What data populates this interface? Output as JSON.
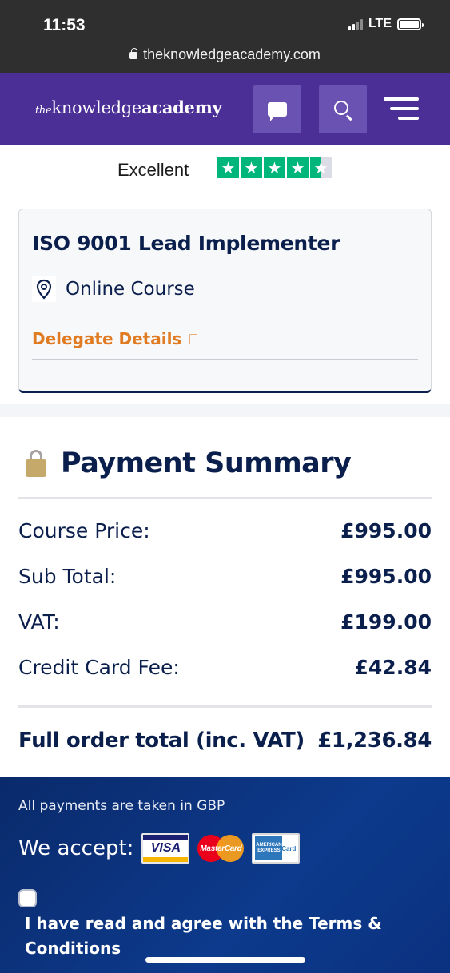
{
  "status_bar": {
    "time": "11:53",
    "network": "LTE"
  },
  "browser": {
    "url": "theknowledgeacademy.com"
  },
  "header": {
    "logo_prefix": "the",
    "logo_main": "knowledge",
    "logo_bold": "academy",
    "brand_color": "#4b2f97",
    "icons": [
      "chat-icon",
      "search-icon",
      "menu-icon"
    ]
  },
  "trustpilot": {
    "label": "Excellent",
    "stars": 4.5,
    "star_color": "#00b67a"
  },
  "course": {
    "title": "ISO 9001 Lead Implementer",
    "type": "Online Course",
    "delegate_link": "Delegate Details",
    "accent_color": "#e07b22"
  },
  "payment_summary": {
    "title": "Payment Summary",
    "rows": [
      {
        "label": "Course Price:",
        "value": "£995.00"
      },
      {
        "label": "Sub Total:",
        "value": "£995.00"
      },
      {
        "label": "VAT:",
        "value": "£199.00"
      },
      {
        "label": "Credit Card Fee:",
        "value": "£42.84"
      }
    ],
    "total_label": "Full order total (inc. VAT)",
    "total_value": "£1,236.84"
  },
  "payment_info": {
    "currency_note": "All payments are taken in GBP",
    "accept_label": "We accept:",
    "cards": [
      "visa",
      "mastercard",
      "american-express"
    ],
    "card_visa_text": "VISA",
    "card_mc_text": "MasterCard",
    "card_amex_text": "AMERICAN EXPRESS",
    "card_amex_side": "Card",
    "terms_text": "I have read and agree with the Terms & Conditions",
    "terms_checked": false
  }
}
